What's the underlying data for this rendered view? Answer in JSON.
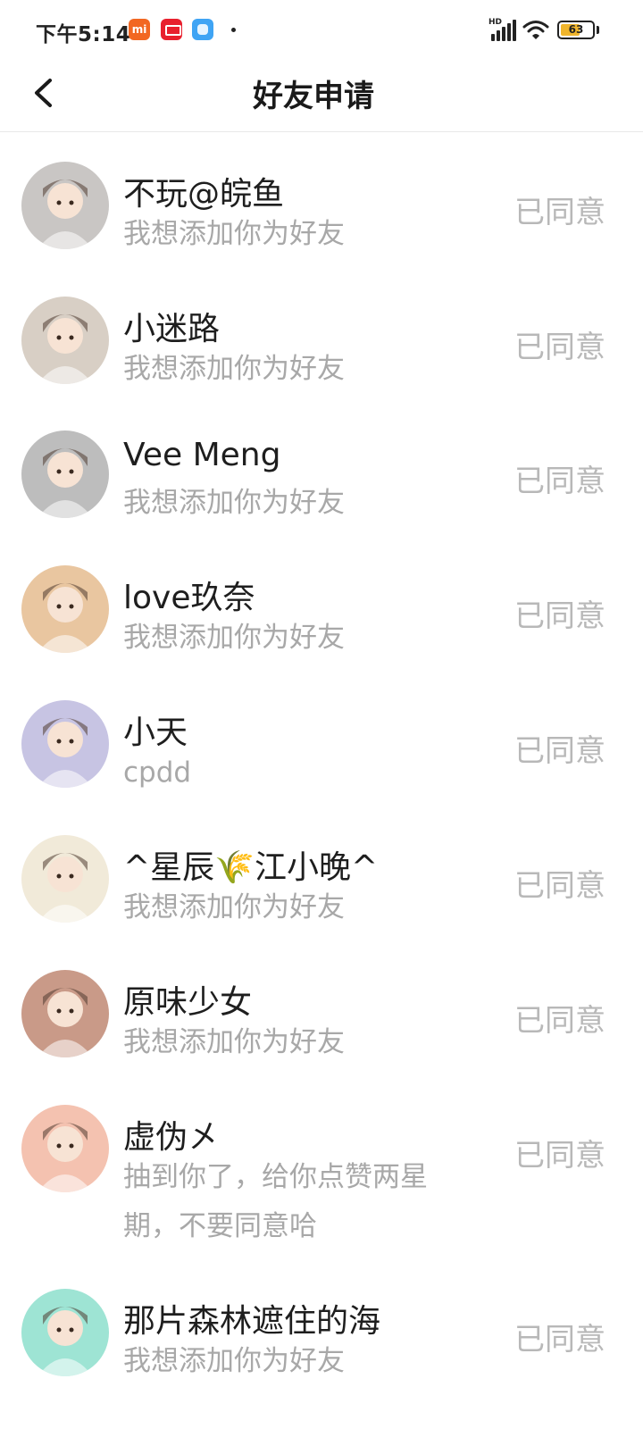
{
  "status_bar": {
    "time": "下午5:14",
    "notif_mi": "mi",
    "network": "HD",
    "battery": "63",
    "battery_level": 0.63,
    "icons": [
      "mi-icon",
      "shop-icon",
      "blue-app-icon",
      "dot-icon",
      "signal-icon",
      "wifi-icon",
      "battery-icon"
    ]
  },
  "header": {
    "title": "好友申请",
    "back_icon": "chevron-left-icon"
  },
  "requests": [
    {
      "name": "不玩@皖鱼",
      "message": "我想添加你为好友",
      "status": "已同意",
      "avatar_color": "#c9c6c4"
    },
    {
      "name": "小迷路",
      "message": "我想添加你为好友",
      "status": "已同意",
      "avatar_color": "#d8cfc5"
    },
    {
      "name": "Vee  Meng",
      "message": "我想添加你为好友",
      "status": "已同意",
      "avatar_color": "#bdbdbd"
    },
    {
      "name": "love玖奈",
      "message": "我想添加你为好友",
      "status": "已同意",
      "avatar_color": "#e9c6a0"
    },
    {
      "name": "小天",
      "message": "cpdd",
      "status": "已同意",
      "avatar_color": "#c7c4e3"
    },
    {
      "name": "^星辰🌾江小晚^",
      "message": "我想添加你为好友",
      "status": "已同意",
      "avatar_color": "#f1ead9"
    },
    {
      "name": "原味少女",
      "message": "我想添加你为好友",
      "status": "已同意",
      "avatar_color": "#c99a88"
    },
    {
      "name": "虚伪㐅",
      "message": "抽到你了，给你点赞两星期，不要同意哈",
      "status": "已同意",
      "avatar_color": "#f4c2b0"
    },
    {
      "name": "那片森林遮住的海",
      "message": "我想添加你为好友",
      "status": "已同意",
      "avatar_color": "#9ee4d4"
    }
  ]
}
